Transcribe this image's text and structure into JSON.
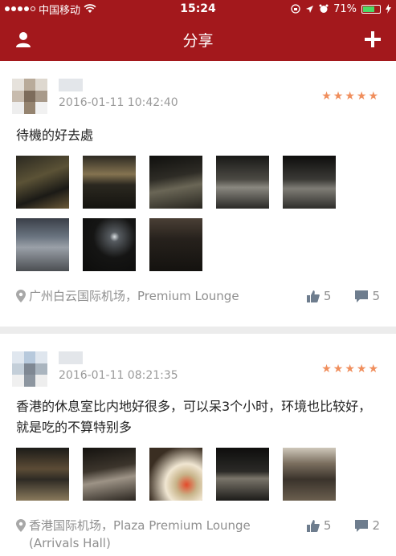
{
  "status_bar": {
    "carrier": "中国移动",
    "time": "15:24",
    "battery": "71%"
  },
  "nav": {
    "title": "分享",
    "left_icon": "user-icon",
    "right_icon": "plus-icon"
  },
  "posts": [
    {
      "timestamp": "2016-01-11 10:42:40",
      "rating": 5,
      "text": "待機的好去處",
      "photo_count": 8,
      "location": "广州白云国际机场，Premium Lounge",
      "likes": "5",
      "comments": "5"
    },
    {
      "timestamp": "2016-01-11 08:21:35",
      "rating": 5,
      "text": "香港的休息室比内地好很多，可以呆3个小时，环境也比较好，就是吃的不算特别多",
      "photo_count": 5,
      "location": "香港国际机场，Plaza Premium Lounge (Arrivals Hall)",
      "likes": "5",
      "comments": "2"
    }
  ],
  "colors": {
    "brand": "#a3181c",
    "star": "#f08e5c",
    "muted": "#9a9a9a"
  }
}
